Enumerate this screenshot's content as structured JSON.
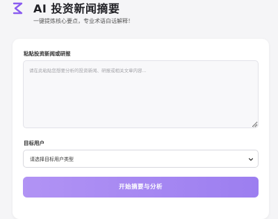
{
  "header": {
    "title": "AI 投资新闻摘要",
    "subtitle": "一键提炼核心要点，专业术语白话解释！",
    "logo_icon": "zigzag-logo-icon"
  },
  "form": {
    "news_label": "粘贴投资新闻或研报",
    "news_placeholder": "请在此粘贴您想要分析的投资新闻、研报或相关文章内容...",
    "news_value": "",
    "user_label": "目标用户",
    "user_select_value": "请选择目标用户类型",
    "submit_label": "开始摘要与分析"
  },
  "colors": {
    "accent": "#9c7ef0",
    "accent_light": "#b193f4",
    "background": "#f5f5f7",
    "logo": "#8a5cf0"
  }
}
